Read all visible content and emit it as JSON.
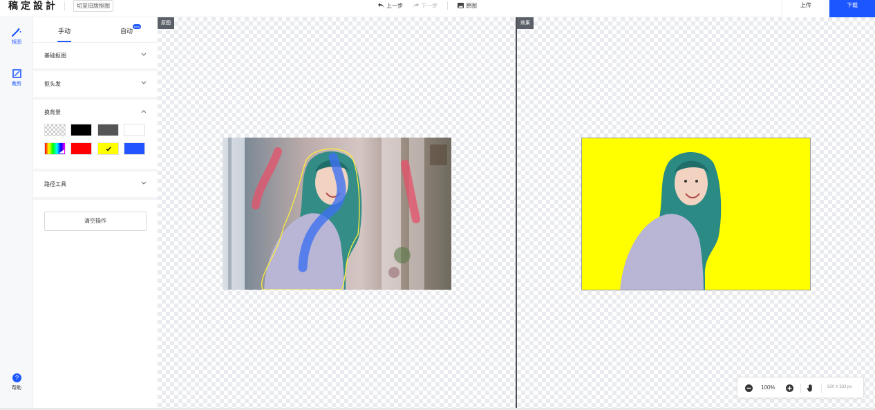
{
  "app": {
    "logo": "稿定設計",
    "old_version_button": "切至旧版抠图"
  },
  "toolbar": {
    "undo": "上一步",
    "redo": "下一步",
    "original": "原图",
    "upload": "上传",
    "download": "下载"
  },
  "rail": {
    "cutout": "抠图",
    "crop": "裁剪",
    "help": "帮助"
  },
  "panel": {
    "tab_manual": "手动",
    "tab_auto": "自动",
    "beta_badge": "beta",
    "sections": {
      "basic": "基础抠图",
      "hair": "抠头发",
      "background": "换背景",
      "path_tool": "路径工具"
    },
    "clear_button": "清空操作",
    "swatches": [
      {
        "name": "transparent",
        "color": "transparent"
      },
      {
        "name": "black",
        "color": "#000000"
      },
      {
        "name": "dark-gray",
        "color": "#555555"
      },
      {
        "name": "white",
        "color": "#ffffff"
      },
      {
        "name": "custom-gradient",
        "color": "gradient"
      },
      {
        "name": "red",
        "color": "#ff0000"
      },
      {
        "name": "yellow",
        "color": "#ffff00",
        "selected": true
      },
      {
        "name": "blue",
        "color": "#2255ff"
      }
    ]
  },
  "canvas": {
    "original_label": "原图",
    "result_label": "效果"
  },
  "zoom": {
    "level": "100%",
    "dimensions": "500 X 333 px"
  },
  "colors": {
    "accent": "#1c56ff",
    "result_background": "#ffff00"
  }
}
